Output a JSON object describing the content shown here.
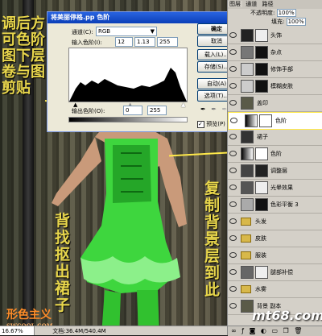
{
  "annotations": {
    "left_top": "调后方可色阶图下层卷与图剪贴",
    "right_mid": "复制背景层到此",
    "center_mid": "背找抠出裙子"
  },
  "levels_dialog": {
    "title": "将美丽停格.pp 色阶",
    "channel_label": "通道(C):",
    "channel_value": "RGB",
    "input_label": "输入色阶(I):",
    "input_values": [
      "12",
      "1.13",
      "255"
    ],
    "output_label": "输出色阶(O):",
    "output_values": [
      "0",
      "255"
    ],
    "buttons": [
      "确定",
      "取消",
      "载入(L)...",
      "存储(S)...",
      "自动(A)",
      "选项(T)..."
    ],
    "preview_label": "预览(P)",
    "preview_checked": true
  },
  "layers_panel": {
    "tabs": [
      "图层",
      "通道",
      "路径"
    ],
    "opacity_label": "不透明度:",
    "opacity_value": "100%",
    "fill_label": "填充:",
    "fill_value": "100%",
    "layers": [
      {
        "name": "头饰",
        "type": "layer"
      },
      {
        "name": "杂点",
        "type": "layer"
      },
      {
        "name": "修饰手部",
        "type": "layer"
      },
      {
        "name": "模糊皮肤",
        "type": "layer"
      },
      {
        "name": "盖印",
        "type": "layer"
      },
      {
        "name": "色阶",
        "type": "adjustment"
      },
      {
        "name": "裙子",
        "type": "layer"
      },
      {
        "name": "色阶",
        "type": "adjustment"
      },
      {
        "name": "调整层",
        "type": "layer"
      },
      {
        "name": "光晕效果",
        "type": "layer"
      },
      {
        "name": "色彩平衡 3",
        "type": "adjustment"
      },
      {
        "name": "头发",
        "type": "folder"
      },
      {
        "name": "皮肤",
        "type": "folder"
      },
      {
        "name": "服装",
        "type": "folder"
      },
      {
        "name": "腿部补偿",
        "type": "layer"
      },
      {
        "name": "水雾",
        "type": "folder"
      },
      {
        "name": "背景 副本",
        "type": "layer"
      }
    ]
  },
  "statusbar": {
    "zoom": "16.67%",
    "doc_info": "文档:36.4M/540.4M"
  },
  "watermarks": {
    "brand": "形色主义",
    "brand_url": "SWCOOL.COM",
    "site": "mt68.com"
  },
  "colors": {
    "annotation": "#e8d64c",
    "dress": "#3ed63e",
    "title_bar": "#0b3fb8"
  }
}
